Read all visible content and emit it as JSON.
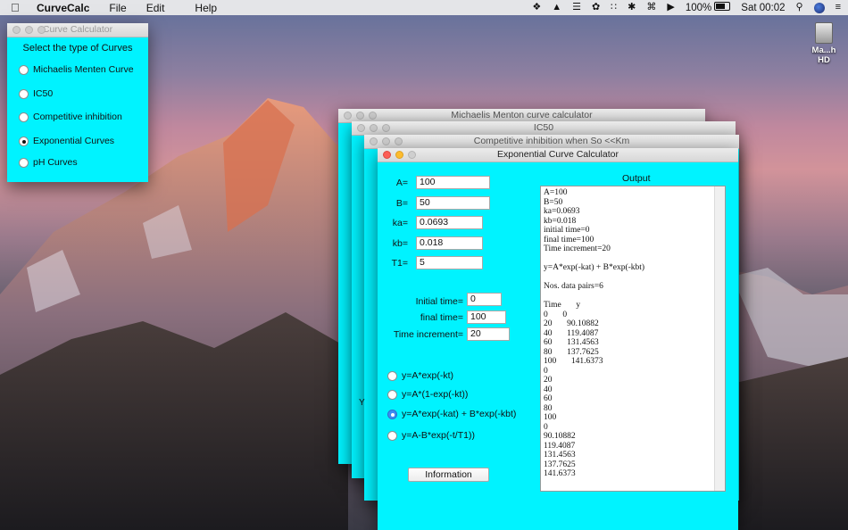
{
  "menubar": {
    "app_name": "CurveCalc",
    "menus": [
      "File",
      "Edit",
      "Help"
    ],
    "battery": "100%",
    "clock": "Sat 00:02"
  },
  "desktop": {
    "disk_label": "Ma...h HD"
  },
  "selector": {
    "title": "Curve Calculator",
    "heading": "Select the type of Curves",
    "options": [
      "Michaelis Menten Curve",
      "IC50",
      "Competitive inhibition",
      "Exponential Curves",
      "pH Curves"
    ],
    "selected": "Exponential Curves"
  },
  "bg_windows": [
    {
      "title": "Michaelis Menton curve calculator"
    },
    {
      "title": "IC50"
    },
    {
      "title": "Competitive inhibition when So <<Km"
    }
  ],
  "bg_peek_text": "Y",
  "calc": {
    "title": "Exponential Curve Calculator",
    "params": [
      {
        "label": "A=",
        "value": "100"
      },
      {
        "label": "B=",
        "value": "50"
      },
      {
        "label": "ka=",
        "value": "0.0693"
      },
      {
        "label": "kb=",
        "value": "0.018"
      },
      {
        "label": "T1=",
        "value": "5"
      }
    ],
    "time": [
      {
        "label": "Initial time=",
        "value": "0"
      },
      {
        "label": "final time=",
        "value": "100"
      },
      {
        "label": "Time increment=",
        "value": "20"
      }
    ],
    "equations": [
      "y=A*exp(-kt)",
      "y=A*(1-exp(-kt))",
      "y=A*exp(-kat) + B*exp(-kbt)",
      "y=A-B*exp(-t/T1))"
    ],
    "selected_equation": "y=A*exp(-kat) + B*exp(-kbt)",
    "info_button": "Information",
    "output_label": "Output",
    "output_lines": [
      "A=100",
      "B=50",
      "ka=0.0693",
      "kb=0.018",
      "initial time=0",
      "final time=100",
      "Time increment=20",
      "",
      "y=A*exp(-kat) + B*exp(-kbt)",
      "",
      "Nos. data pairs=6",
      "",
      "Time       y",
      "0       0",
      "20       90.10882",
      "40       119.4087",
      "60       131.4563",
      "80       137.7625",
      "100       141.6373",
      "0",
      "20",
      "40",
      "60",
      "80",
      "100",
      "0",
      "90.10882",
      "119.4087",
      "131.4563",
      "137.7625",
      "141.6373"
    ]
  }
}
